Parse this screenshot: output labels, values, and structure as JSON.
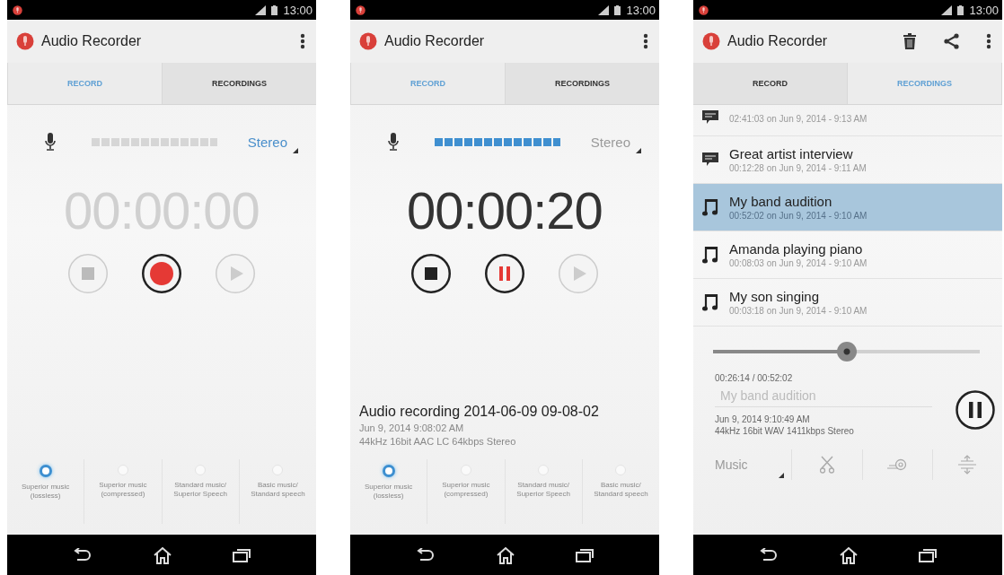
{
  "phones": [
    {
      "status_bar": {
        "time": "13:00"
      },
      "app_bar": {
        "title": "Audio Recorder",
        "actions": [
          {
            "kind": "overflow"
          }
        ]
      },
      "tabs": [
        {
          "label": "RECORD",
          "selected": true
        },
        {
          "label": "RECORDINGS",
          "selected": false
        }
      ],
      "screen": {
        "kind": "recorder",
        "input": {
          "mode": "Stereo",
          "mode_disabled": false,
          "level": 0
        },
        "timer": {
          "text": "00:00:00",
          "disabled": true
        },
        "controls": [
          {
            "kind": "stop",
            "disabled": true
          },
          {
            "kind": "record",
            "disabled": false
          },
          {
            "kind": "play",
            "disabled": true
          }
        ],
        "quality_options": [
          {
            "label": "Superior music\n(lossless)",
            "selected": true
          },
          {
            "label": "Superior music\n(compressed)",
            "selected": false
          },
          {
            "label": "Standard music/\nSuperior Speech",
            "selected": false
          },
          {
            "label": "Basic music/\nStandard speech",
            "selected": false
          }
        ]
      }
    },
    {
      "status_bar": {
        "time": "13:00"
      },
      "app_bar": {
        "title": "Audio Recorder",
        "actions": [
          {
            "kind": "overflow"
          }
        ]
      },
      "tabs": [
        {
          "label": "RECORD",
          "selected": true
        },
        {
          "label": "RECORDINGS",
          "selected": false
        }
      ],
      "screen": {
        "kind": "recorder",
        "input": {
          "mode": "Stereo",
          "mode_disabled": true,
          "level": 1
        },
        "timer": {
          "text": "00:00:20",
          "disabled": false
        },
        "controls": [
          {
            "kind": "stop",
            "disabled": false
          },
          {
            "kind": "pause",
            "disabled": false
          },
          {
            "kind": "play",
            "disabled": true
          }
        ],
        "last_recording": {
          "title": "Audio recording 2014-06-09 09-08-02",
          "date": "Jun 9, 2014 9:08:02 AM",
          "format": "44kHz 16bit AAC LC 64kbps Stereo"
        },
        "quality_options": [
          {
            "label": "Superior music\n(lossless)",
            "selected": true
          },
          {
            "label": "Superior music\n(compressed)",
            "selected": false
          },
          {
            "label": "Standard music/\nSuperior Speech",
            "selected": false
          },
          {
            "label": "Basic music/\nStandard speech",
            "selected": false
          }
        ]
      }
    },
    {
      "status_bar": {
        "time": "13:00"
      },
      "app_bar": {
        "title": "Audio Recorder",
        "actions": [
          {
            "kind": "delete"
          },
          {
            "kind": "share"
          },
          {
            "kind": "overflow"
          }
        ]
      },
      "tabs": [
        {
          "label": "RECORD",
          "selected": false
        },
        {
          "label": "RECORDINGS",
          "selected": true
        }
      ],
      "screen": {
        "kind": "recordings",
        "items": [
          {
            "kind": "speech",
            "subtitle": "02:41:03 on Jun 9, 2014 - 9:13 AM",
            "selected": false
          },
          {
            "kind": "speech",
            "title": "Great artist interview",
            "subtitle": "00:12:28 on Jun 9, 2014 - 9:11 AM",
            "selected": false
          },
          {
            "kind": "music",
            "title": "My band audition",
            "subtitle": "00:52:02 on Jun 9, 2014 - 9:10 AM",
            "selected": true
          },
          {
            "kind": "music",
            "title": "Amanda playing piano",
            "subtitle": "00:08:03 on Jun 9, 2014 - 9:10 AM",
            "selected": false
          },
          {
            "kind": "music",
            "title": "My son singing",
            "subtitle": "00:03:18 on Jun 9, 2014 - 9:10 AM",
            "selected": false
          }
        ],
        "player": {
          "level": 0.5,
          "position": "00:26:14 / 00:52:02",
          "name": "My band audition",
          "date": "Jun 9, 2014 9:10:49 AM",
          "format": "44kHz 16bit WAV 1411kbps Stereo",
          "button": {
            "kind": "pause"
          }
        },
        "toolbar": {
          "category": "Music",
          "category_disabled": true,
          "tools": [
            {
              "kind": "cut"
            },
            {
              "kind": "noise"
            },
            {
              "kind": "level"
            }
          ]
        }
      }
    }
  ]
}
